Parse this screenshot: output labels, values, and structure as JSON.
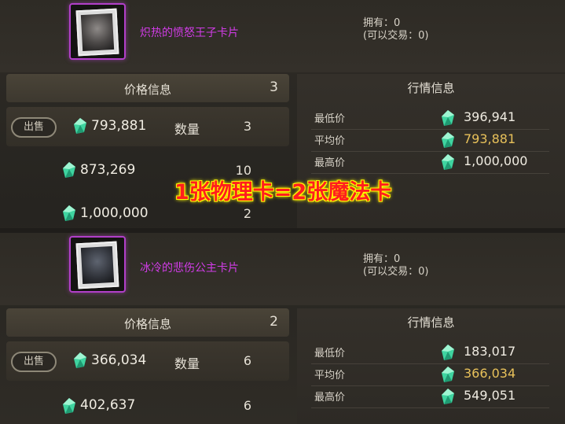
{
  "cards": [
    {
      "name": "炽热的愤怒王子卡片",
      "own": "拥有：0",
      "tradeable": "(可以交易：0)",
      "price_info": {
        "title": "价格信息",
        "count": "3",
        "sell_label": "出售",
        "qty_label": "数量",
        "listings": [
          {
            "price": "793,881",
            "qty": "3"
          },
          {
            "price": "873,269",
            "qty": "10"
          },
          {
            "price": "1,000,000",
            "qty": "2"
          }
        ]
      },
      "market_info": {
        "title": "行情信息",
        "rows": [
          {
            "label": "最低价",
            "value": "396,941"
          },
          {
            "label": "平均价",
            "value": "793,881"
          },
          {
            "label": "最高价",
            "value": "1,000,000"
          }
        ]
      }
    },
    {
      "name": "冰冷的悲伤公主卡片",
      "own": "拥有：0",
      "tradeable": "(可以交易：0)",
      "price_info": {
        "title": "价格信息",
        "count": "2",
        "sell_label": "出售",
        "qty_label": "数量",
        "listings": [
          {
            "price": "366,034",
            "qty": "6"
          },
          {
            "price": "402,637",
            "qty": "6"
          }
        ]
      },
      "market_info": {
        "title": "行情信息",
        "rows": [
          {
            "label": "最低价",
            "value": "183,017"
          },
          {
            "label": "平均价",
            "value": "366,034"
          },
          {
            "label": "最高价",
            "value": "549,051"
          }
        ]
      }
    }
  ],
  "overlay_text": "1张物理卡=2张魔法卡",
  "colors": {
    "card_name": "#d13ce7",
    "avg_price": "#e8c15a",
    "overlay": "#ff1e1e",
    "gem": "#3fd4a0"
  },
  "icons": {
    "currency": "green-crystal-gem-icon"
  }
}
